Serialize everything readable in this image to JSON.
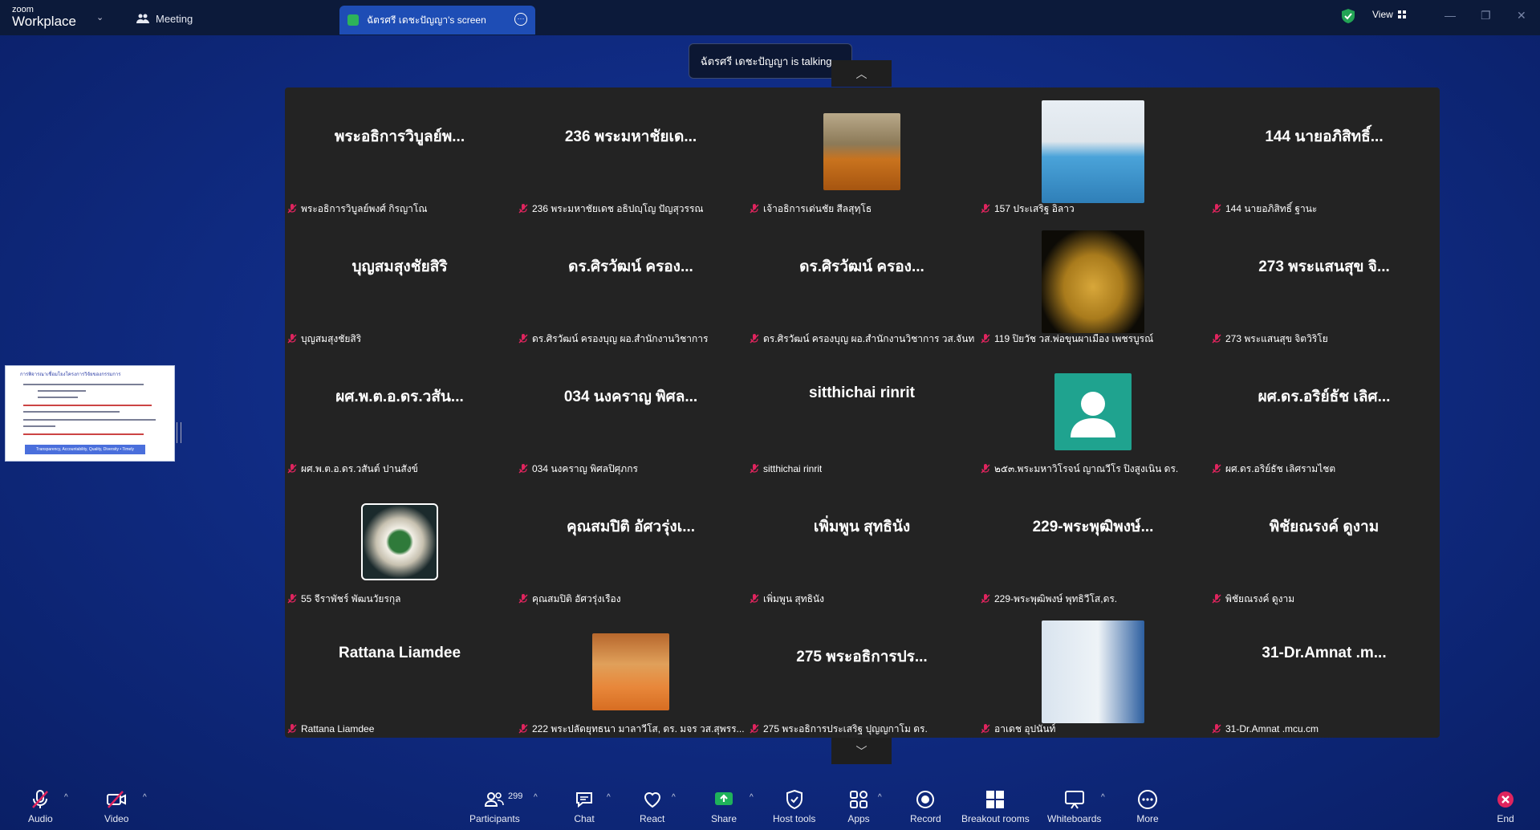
{
  "titlebar": {
    "logo_top": "zoom",
    "logo_bottom": "Workplace",
    "meeting_label": "Meeting",
    "screen_tab_label": "ฉัตรศรี เดชะปัญญา's screen",
    "view_label": "View"
  },
  "talking": "ฉัตรศรี เดชะปัญญา is talking...",
  "tiles": [
    {
      "big": "พระอธิการวิบูลย์พ...",
      "label": "พระอธิการวิบูลย์พงศ์ กิรญาโณ"
    },
    {
      "big": "236 พระมหาชัยเด...",
      "label": "236 พระมหาชัยเดช อธิปญฺโญ ปัญสุวรรณ"
    },
    {
      "big": "",
      "label": "เจ้าอธิการเด่นชัย  สีลสุทฺโธ"
    },
    {
      "big": "",
      "label": "157 ประเสริฐ อิลาว"
    },
    {
      "big": "144 นายอภิสิทธิ์...",
      "label": "144 นายอภิสิทธิ์ ฐานะ"
    },
    {
      "big": "บุญสมสุงชัยสิริ",
      "label": "บุญสมสุงชัยสิริ"
    },
    {
      "big": "ดร.ศิรวัฒน์ ครอง...",
      "label": "ดร.ศิรวัฒน์ ครองบุญ ผอ.สำนักงานวิชาการ"
    },
    {
      "big": "ดร.ศิรวัฒน์ ครอง...",
      "label": "ดร.ศิรวัฒน์ ครองบุญ ผอ.สำนักงานวิชาการ วส.จันท..."
    },
    {
      "big": "",
      "label": "119  ปิยวัช    วส.พ่อขุนผาเมือง เพชรบูรณ์"
    },
    {
      "big": "273 พระแสนสุข จิ...",
      "label": "273 พระแสนสุข จิตวิริโย"
    },
    {
      "big": "ผศ.พ.ต.อ.ดร.วสัน...",
      "label": "ผศ.พ.ต.อ.ดร.วสันต์ ปานสังข์"
    },
    {
      "big": "034 นงคราญ พิศล...",
      "label": "034 นงคราญ พิศลปิศุภกร"
    },
    {
      "big": "sitthichai rinrit",
      "label": "sitthichai rinrit"
    },
    {
      "big": "",
      "label": "๒๕๓.พระมหาวิโรจน์ ญาณวีโร ปิงสูงเนิน ดร."
    },
    {
      "big": "ผศ.ดร.อริย์ธัช เลิศ...",
      "label": "ผศ.ดร.อริย์ธัช เลิศรามไชต"
    },
    {
      "big": "",
      "label": "55 จีราพัชร์ พัฒนวัยรกุล"
    },
    {
      "big": "คุณสมปิติ อัศวรุ่งเ...",
      "label": "คุณสมปิติ อัศวรุ่งเรือง"
    },
    {
      "big": "เพิ่มพูน สุทธินัง",
      "label": "เพิ่มพูน สุทธินัง"
    },
    {
      "big": "229-พระพุฒิพงษ์...",
      "label": "229-พระพุฒิพงษ์ พุทธิวีโส,ดร."
    },
    {
      "big": "พิชัยณรงค์  ดูงาม",
      "label": "พิชัยณรงค์  ดูงาม"
    },
    {
      "big": "Rattana Liamdee",
      "label": "Rattana Liamdee"
    },
    {
      "big": "",
      "label": "222 พระปลัดยุทธนา มาลาวีโส, ดร. มจร วส.สุพรร..."
    },
    {
      "big": "275 พระอธิการปร...",
      "label": "275 พระอธิการประเสริฐ ปุญญกาโม ดร."
    },
    {
      "big": "",
      "label": "อาเดช อุปนันท์"
    },
    {
      "big": "31-Dr.Amnat  .m...",
      "label": "31-Dr.Amnat .mcu.cm"
    }
  ],
  "thumbnail": {
    "title": "การพิจารณาเชื่อมโยงโครงการวิจัยของกรรมการ",
    "bar": "Transparency, Accountability, Quality, Diversity • Timely"
  },
  "toolbar": {
    "audio": "Audio",
    "video": "Video",
    "participants": "Participants",
    "participant_count": "299",
    "chat": "Chat",
    "react": "React",
    "share": "Share",
    "host_tools": "Host tools",
    "apps": "Apps",
    "record": "Record",
    "breakout": "Breakout rooms",
    "whiteboards": "Whiteboards",
    "more": "More",
    "end": "End"
  },
  "colors": {
    "accent": "#1e4db5",
    "muted_mic": "#e0245e",
    "share_green": "#1fb25a",
    "end_red": "#e0245e"
  }
}
